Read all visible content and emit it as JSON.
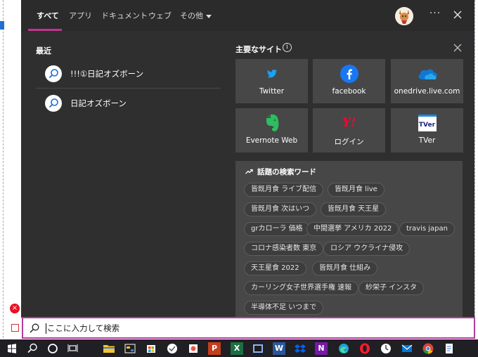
{
  "tabs": [
    {
      "label": "すべて",
      "active": true
    },
    {
      "label": "アプリ"
    },
    {
      "label": "ドキュメント"
    },
    {
      "label": "ウェブ"
    },
    {
      "label": "その他"
    }
  ],
  "topbar": {
    "more_label": "···"
  },
  "recent": {
    "title": "最近",
    "items": [
      {
        "label": "!!!①日記オズボーン"
      },
      {
        "label": "日記オズボーン"
      }
    ]
  },
  "top_sites": {
    "title": "主要なサイト",
    "info_label": "i",
    "tiles": [
      {
        "label": "Twitter",
        "icon": "twitter-icon"
      },
      {
        "label": "facebook",
        "icon": "facebook-icon"
      },
      {
        "label": "onedrive.live.com",
        "icon": "onedrive-icon"
      },
      {
        "label": "Evernote Web",
        "icon": "evernote-icon"
      },
      {
        "label": "ログイン",
        "icon": "yahoo-icon",
        "icon_text": "Y!"
      },
      {
        "label": "TVer",
        "icon": "tver-icon",
        "icon_text": "TVer"
      }
    ]
  },
  "trending": {
    "title": "話題の検索ワード",
    "chips": [
      "皆既月食 ライブ配信",
      "皆既月食 live",
      "皆既月食 次はいつ",
      "皆既月食 天王星",
      "grカローラ 価格",
      "中間選挙 アメリカ 2022",
      "travis japan",
      "コロナ感染者数 東京",
      "ロシア ウクライナ侵攻",
      "天王星食 2022",
      "皆既月食 仕組み",
      "カーリング女子世界選手権 速報",
      "紗栄子 インスタ",
      "半導体不足 いつまで"
    ]
  },
  "search": {
    "placeholder": "ここに入力して検索"
  },
  "background": {
    "error_icon_text": "×"
  },
  "taskbar": {
    "icons": [
      "windows-start-icon",
      "search-icon",
      "cortana-icon",
      "task-view-icon",
      "file-explorer-icon",
      "app-icon",
      "store-icon",
      "powerpoint-icon",
      "excel-icon",
      "app-icon",
      "word-icon",
      "dropbox-icon",
      "onenote-icon",
      "edge-icon",
      "opera-icon",
      "clock-app-icon",
      "mail-icon",
      "chrome-icon",
      "notepad-icon"
    ],
    "app_letters": {
      "powerpoint": "P",
      "excel": "X",
      "word": "W",
      "onenote": "N"
    }
  },
  "colors": {
    "accent": "#c2338f",
    "panel_bg": "#2f2f2f",
    "tile_bg": "#474747",
    "facebook": "#1877f2",
    "twitter": "#1da1f2",
    "onedrive": "#0f78d4",
    "evernote": "#2dbe60",
    "yahoo": "#ff0033"
  }
}
